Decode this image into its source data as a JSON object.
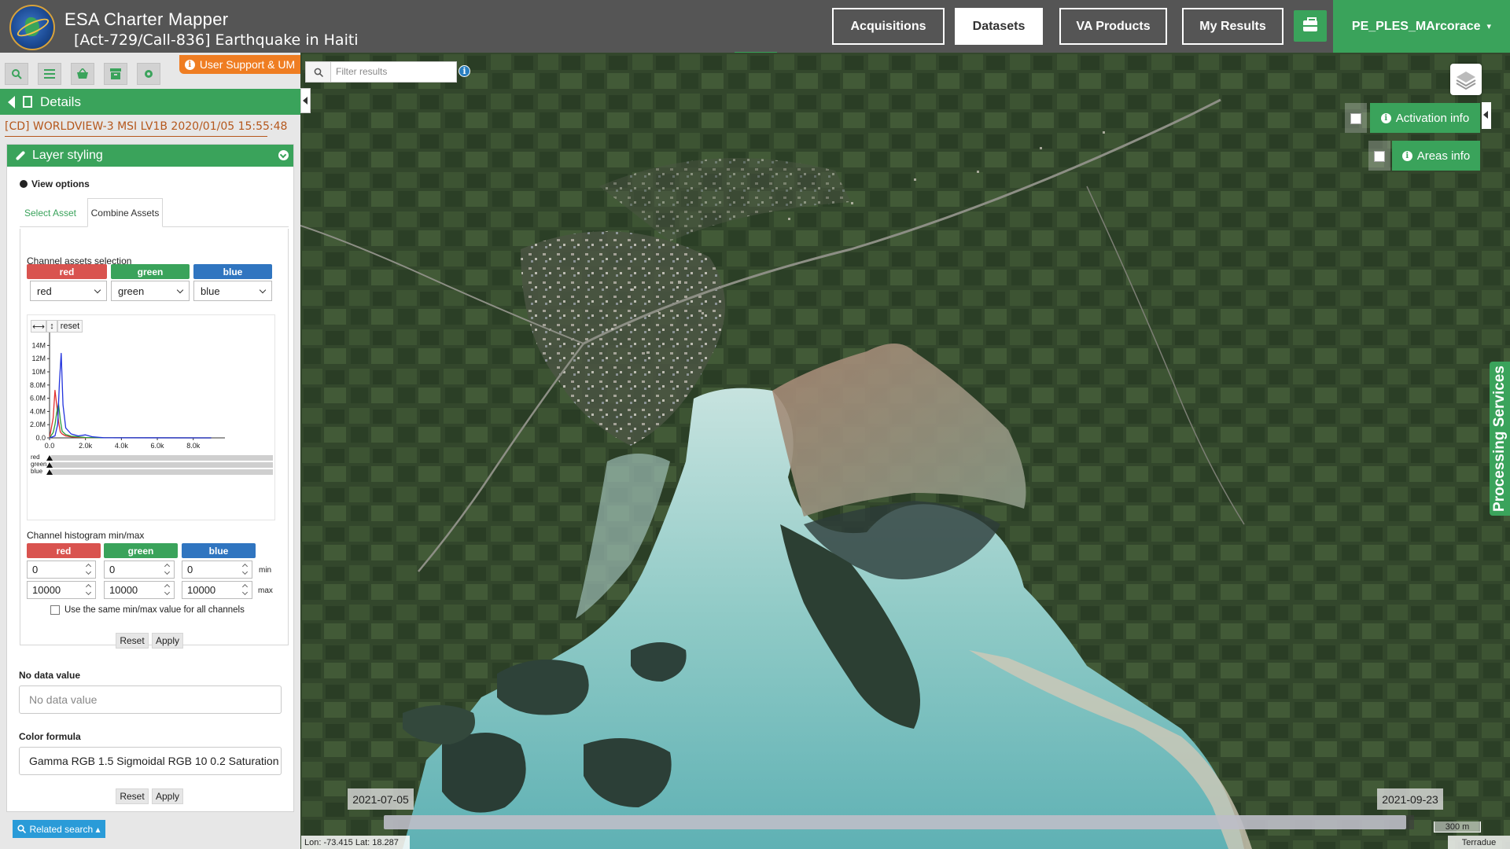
{
  "header": {
    "app_title": "ESA Charter Mapper",
    "subtitle": "[Act-729/Call-836] Earthquake in Haiti",
    "nav": [
      {
        "label": "Acquisitions",
        "active": false
      },
      {
        "label": "Datasets",
        "active": true
      },
      {
        "label": "VA Products",
        "active": false
      },
      {
        "label": "My Results",
        "active": false
      }
    ],
    "user": "PE_PLES_MArcorace",
    "user_caret": "▾",
    "briefcase_icon": "briefcase-icon",
    "accent_color": "#3aa35b"
  },
  "sidebar": {
    "tools": [
      "search-icon",
      "list-icon",
      "basket-icon",
      "archive-icon",
      "gear-icon"
    ],
    "support": "User Support & UM",
    "details_label": "Details",
    "dataset_title": "[CD] WORLDVIEW-3 MSI LV1B 2020/01/05 15:55:48",
    "layer_styling": {
      "title": "Layer styling",
      "view_options": "View options",
      "tabs": [
        {
          "label": "Select Asset",
          "active": false
        },
        {
          "label": "Combine Assets",
          "active": true
        }
      ],
      "channel_assets_label": "Channel assets selection",
      "channels": [
        {
          "name": "red",
          "selected": "red",
          "color": "#d9534f"
        },
        {
          "name": "green",
          "selected": "green",
          "color": "#3aa35b"
        },
        {
          "name": "blue",
          "selected": "blue",
          "color": "#3075c0"
        }
      ],
      "histogram_buttons": {
        "pan_h": "⟷",
        "pan_v": "↕",
        "reset": "reset"
      },
      "minmax_label": "Channel histogram min/max",
      "minmax": [
        {
          "channel": "red",
          "min": "0",
          "max": "10000"
        },
        {
          "channel": "green",
          "min": "0",
          "max": "10000"
        },
        {
          "channel": "blue",
          "min": "0",
          "max": "10000"
        }
      ],
      "min_label": "min",
      "max_label": "max",
      "same_minmax_label": "Use the same min/max value for all channels",
      "reset_label": "Reset",
      "apply_label": "Apply",
      "nodata_label": "No data value",
      "nodata_placeholder": "No data value",
      "color_formula_label": "Color formula",
      "color_formula_value": "Gamma RGB 1.5 Sigmoidal RGB 10 0.2 Saturation"
    },
    "related_search": "Related search ▴"
  },
  "chart_data": {
    "type": "line",
    "title": "",
    "xlabel": "",
    "ylabel": "",
    "xlim": [
      0,
      9500
    ],
    "ylim": [
      0,
      15000000
    ],
    "xticks": [
      0,
      2000,
      4000,
      6000,
      8000
    ],
    "xtick_labels": [
      "0.0",
      "2.0k",
      "4.0k",
      "6.0k",
      "8.0k"
    ],
    "yticks": [
      0,
      2000000,
      4000000,
      6000000,
      8000000,
      10000000,
      12000000,
      14000000
    ],
    "ytick_labels": [
      "0.0",
      "2.0M",
      "4.0M",
      "6.0M",
      "8.0M",
      "10M",
      "12M",
      "14M"
    ],
    "grid": false,
    "series": [
      {
        "name": "red",
        "color": "#e03030",
        "x": [
          0,
          200,
          300,
          400,
          500,
          600,
          700,
          900,
          1200,
          1600,
          2000,
          3000,
          9000
        ],
        "y": [
          0,
          3000000,
          7200000,
          5000000,
          2500000,
          900000,
          600000,
          300000,
          150000,
          80000,
          40000,
          10000,
          0
        ]
      },
      {
        "name": "green",
        "color": "#2a9d3a",
        "x": [
          0,
          200,
          300,
          400,
          500,
          600,
          700,
          900,
          1200,
          1600,
          2000,
          3000,
          9000
        ],
        "y": [
          0,
          800000,
          2000000,
          3800000,
          5200000,
          2700000,
          1000000,
          500000,
          250000,
          150000,
          60000,
          10000,
          0
        ]
      },
      {
        "name": "blue",
        "color": "#2233dd",
        "x": [
          0,
          300,
          450,
          550,
          650,
          750,
          900,
          1200,
          1600,
          2000,
          2400,
          3000,
          9000
        ],
        "y": [
          0,
          300000,
          2000000,
          8500000,
          12800000,
          5000000,
          1500000,
          600000,
          300000,
          450000,
          150000,
          20000,
          0
        ]
      }
    ],
    "range_labels": [
      "red",
      "green",
      "blue"
    ]
  },
  "map": {
    "filter_placeholder": "Filter results",
    "activation_info": "Activation info",
    "areas_info": "Areas info",
    "processing_services": "Processing Services",
    "date_start": "2021-07-05",
    "date_end": "2021-09-23",
    "scale": "300 m",
    "attribution": "Terradue",
    "coords": "Lon: -73.415 Lat: 18.287",
    "layers_icon": "layers-icon"
  }
}
